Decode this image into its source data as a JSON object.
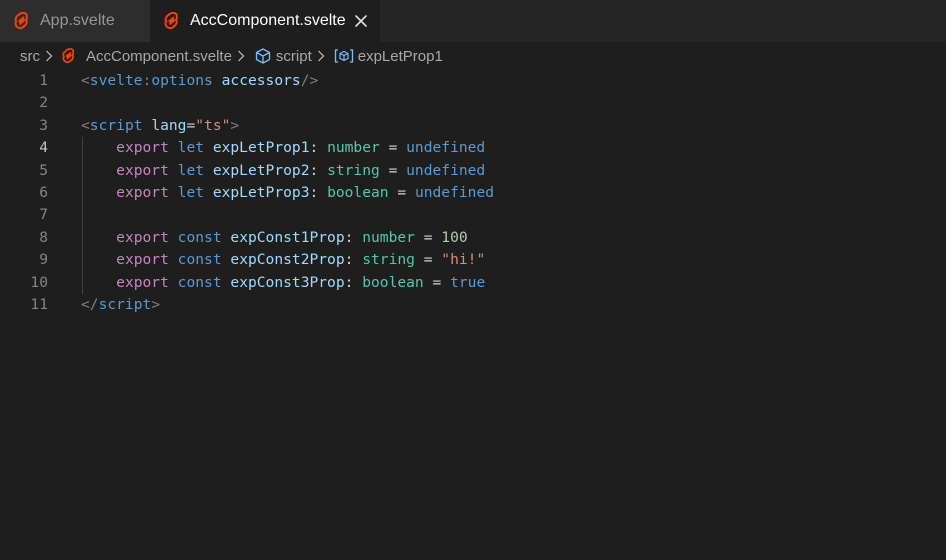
{
  "tabs": [
    {
      "label": "App.svelte",
      "active": false
    },
    {
      "label": "AccComponent.svelte",
      "active": true
    }
  ],
  "breadcrumb": {
    "folder": "src",
    "file": "AccComponent.svelte",
    "section": "script",
    "symbol": "expLetProp1"
  },
  "editor": {
    "current_line": 4,
    "line_numbers": [
      "1",
      "2",
      "3",
      "4",
      "5",
      "6",
      "7",
      "8",
      "9",
      "10",
      "11"
    ],
    "lines": [
      [
        {
          "t": "<",
          "c": "punct"
        },
        {
          "t": "svelte",
          "c": "tag"
        },
        {
          "t": ":",
          "c": "punct"
        },
        {
          "t": "options",
          "c": "tag"
        },
        {
          "t": " ",
          "c": "op"
        },
        {
          "t": "accessors",
          "c": "attr"
        },
        {
          "t": "/>",
          "c": "punct"
        }
      ],
      [],
      [
        {
          "t": "<",
          "c": "punct"
        },
        {
          "t": "script",
          "c": "tag"
        },
        {
          "t": " ",
          "c": "op"
        },
        {
          "t": "lang",
          "c": "attr"
        },
        {
          "t": "=",
          "c": "op"
        },
        {
          "t": "\"ts\"",
          "c": "str"
        },
        {
          "t": ">",
          "c": "punct"
        }
      ],
      [
        {
          "t": "    ",
          "c": "op"
        },
        {
          "t": "export",
          "c": "ctrl"
        },
        {
          "t": " ",
          "c": "op"
        },
        {
          "t": "let",
          "c": "kw"
        },
        {
          "t": " ",
          "c": "op"
        },
        {
          "t": "expLetProp1",
          "c": "var"
        },
        {
          "t": ": ",
          "c": "op"
        },
        {
          "t": "number",
          "c": "type"
        },
        {
          "t": " = ",
          "c": "op"
        },
        {
          "t": "undefined",
          "c": "kw"
        }
      ],
      [
        {
          "t": "    ",
          "c": "op"
        },
        {
          "t": "export",
          "c": "ctrl"
        },
        {
          "t": " ",
          "c": "op"
        },
        {
          "t": "let",
          "c": "kw"
        },
        {
          "t": " ",
          "c": "op"
        },
        {
          "t": "expLetProp2",
          "c": "var"
        },
        {
          "t": ": ",
          "c": "op"
        },
        {
          "t": "string",
          "c": "type"
        },
        {
          "t": " = ",
          "c": "op"
        },
        {
          "t": "undefined",
          "c": "kw"
        }
      ],
      [
        {
          "t": "    ",
          "c": "op"
        },
        {
          "t": "export",
          "c": "ctrl"
        },
        {
          "t": " ",
          "c": "op"
        },
        {
          "t": "let",
          "c": "kw"
        },
        {
          "t": " ",
          "c": "op"
        },
        {
          "t": "expLetProp3",
          "c": "var"
        },
        {
          "t": ": ",
          "c": "op"
        },
        {
          "t": "boolean",
          "c": "type"
        },
        {
          "t": " = ",
          "c": "op"
        },
        {
          "t": "undefined",
          "c": "kw"
        }
      ],
      [],
      [
        {
          "t": "    ",
          "c": "op"
        },
        {
          "t": "export",
          "c": "ctrl"
        },
        {
          "t": " ",
          "c": "op"
        },
        {
          "t": "const",
          "c": "kw"
        },
        {
          "t": " ",
          "c": "op"
        },
        {
          "t": "expConst1Prop",
          "c": "var"
        },
        {
          "t": ": ",
          "c": "op"
        },
        {
          "t": "number",
          "c": "type"
        },
        {
          "t": " = ",
          "c": "op"
        },
        {
          "t": "100",
          "c": "num"
        }
      ],
      [
        {
          "t": "    ",
          "c": "op"
        },
        {
          "t": "export",
          "c": "ctrl"
        },
        {
          "t": " ",
          "c": "op"
        },
        {
          "t": "const",
          "c": "kw"
        },
        {
          "t": " ",
          "c": "op"
        },
        {
          "t": "expConst2Prop",
          "c": "var"
        },
        {
          "t": ": ",
          "c": "op"
        },
        {
          "t": "string",
          "c": "type"
        },
        {
          "t": " = ",
          "c": "op"
        },
        {
          "t": "\"hi!\"",
          "c": "str"
        }
      ],
      [
        {
          "t": "    ",
          "c": "op"
        },
        {
          "t": "export",
          "c": "ctrl"
        },
        {
          "t": " ",
          "c": "op"
        },
        {
          "t": "const",
          "c": "kw"
        },
        {
          "t": " ",
          "c": "op"
        },
        {
          "t": "expConst3Prop",
          "c": "var"
        },
        {
          "t": ": ",
          "c": "op"
        },
        {
          "t": "boolean",
          "c": "type"
        },
        {
          "t": " = ",
          "c": "op"
        },
        {
          "t": "true",
          "c": "kw"
        }
      ],
      [
        {
          "t": "</",
          "c": "punct"
        },
        {
          "t": "script",
          "c": "tag"
        },
        {
          "t": ">",
          "c": "punct"
        }
      ]
    ]
  },
  "icons": {
    "svelte_logo": "svelte-logo-icon",
    "close": "close-icon",
    "chevron": "chevron-right-icon",
    "module": "cube-icon",
    "variable": "variable-icon"
  },
  "colors": {
    "background": "#1e1e1e",
    "svelte_orange": "#ff3e00"
  }
}
